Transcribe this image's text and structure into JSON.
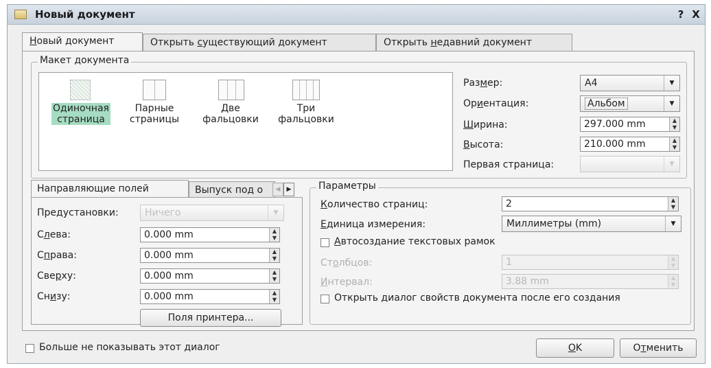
{
  "window": {
    "title": "Новый документ",
    "help_label": "?",
    "close_label": "X"
  },
  "tabs": [
    {
      "label": "Новый документ",
      "ul": "Н",
      "rest": "овый документ"
    },
    {
      "pre": "Открыть ",
      "ul": "с",
      "rest": "уществующий документ"
    },
    {
      "pre": "Открыть ",
      "ul": "н",
      "rest": "едавний документ"
    }
  ],
  "layout_group": {
    "title": "Макет документа",
    "items": [
      {
        "line1": "Одиночная",
        "line2": "страница",
        "selected": true
      },
      {
        "line1": "Парные",
        "line2": "страницы",
        "selected": false
      },
      {
        "line1": "Две",
        "line2": "фальцовки",
        "selected": false
      },
      {
        "line1": "Три",
        "line2": "фальцовки",
        "selected": false
      }
    ]
  },
  "page_settings": {
    "size_label_pre": "Раз",
    "size_label_ul": "м",
    "size_label_post": "ер:",
    "size_value": "A4",
    "orient_label_pre": "Ор",
    "orient_label_ul": "и",
    "orient_label_post": "ентация:",
    "orient_value": "Альбом",
    "width_label_ul": "Ш",
    "width_label_post": "ирина:",
    "width_value": "297.000 mm",
    "height_label_ul": "В",
    "height_label_post": "ысота:",
    "height_value": "210.000 mm",
    "first_page_label": "Первая страница:",
    "first_page_value": ""
  },
  "margins_tabs": {
    "tab1": "Направляющие полей",
    "tab2": "Выпуск под о"
  },
  "margins": {
    "preset_label": "Предустановки:",
    "preset_value": "Ничего",
    "left_label_pre": "С",
    "left_label_ul": "л",
    "left_label_post": "ева:",
    "left_value": "0.000 mm",
    "right_label_pre": "С",
    "right_label_ul": "п",
    "right_label_post": "рава:",
    "right_value": "0.000 mm",
    "top_label_pre": "Све",
    "top_label_ul": "р",
    "top_label_post": "ху:",
    "top_value": "0.000 mm",
    "bottom_label_pre": "Сн",
    "bottom_label_ul": "и",
    "bottom_label_post": "зу:",
    "bottom_value": "0.000 mm",
    "printer_button": "Поля принтера..."
  },
  "params": {
    "title": "Параметры",
    "pages_label_ul": "К",
    "pages_label_post": "оличество страниц:",
    "pages_value": "2",
    "unit_label_ul": "Е",
    "unit_label_post": "диница измерения:",
    "unit_value": "Миллиметры (mm)",
    "autoframes_label_ul": "А",
    "autoframes_label_post": "втосоздание текстовых рамок",
    "columns_label_pre": "Ст",
    "columns_label_ul": "о",
    "columns_label_post": "лбцов:",
    "columns_value": "1",
    "interval_label_ul": "И",
    "interval_label_post": "нтервал:",
    "interval_value": "3.88 mm",
    "open_props_label": "Открыть диалог свойств документа после его создания"
  },
  "footer": {
    "dont_show_label": "Больше не показывать этот диалог",
    "ok_ul": "O",
    "ok_rest": "K",
    "cancel_pre": "О",
    "cancel_ul": "т",
    "cancel_rest": "менить"
  }
}
